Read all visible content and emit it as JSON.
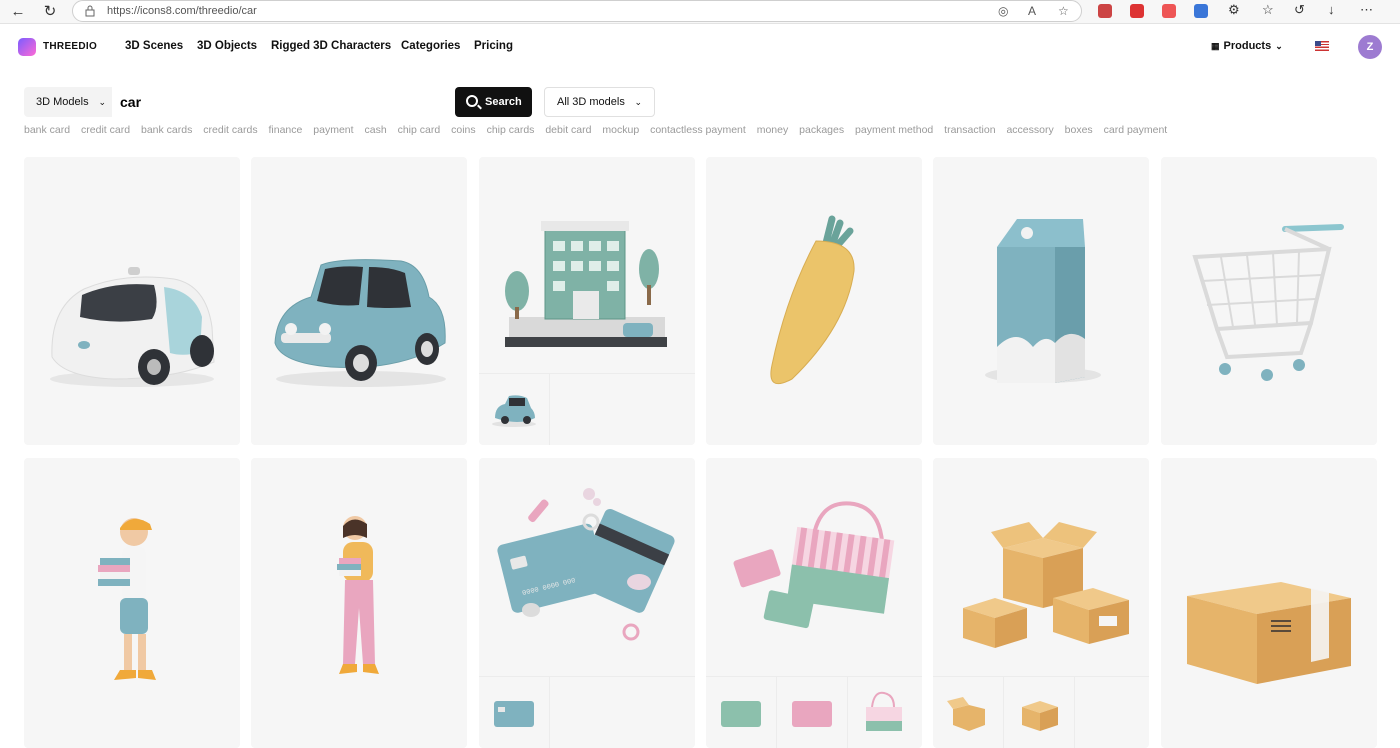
{
  "browser": {
    "url": "https://icons8.com/threedio/car"
  },
  "header": {
    "logo": "THREEDIO",
    "nav": [
      "3D Scenes",
      "3D Objects",
      "Rigged 3D Characters",
      "Categories",
      "Pricing"
    ],
    "products": "Products",
    "avatar_initial": "Z"
  },
  "search": {
    "type_label": "3D Models",
    "query": "car",
    "button": "Search",
    "scope_label": "All 3D models",
    "tags": [
      "bank card",
      "credit card",
      "bank cards",
      "credit cards",
      "finance",
      "payment",
      "cash",
      "chip card",
      "coins",
      "chip cards",
      "debit card",
      "mockup",
      "contactless payment",
      "money",
      "packages",
      "payment method",
      "transaction",
      "accessory",
      "boxes",
      "card payment"
    ]
  },
  "results": [
    {
      "name": "self-driving-car-model",
      "thumbs": []
    },
    {
      "name": "retro-car-model",
      "thumbs": []
    },
    {
      "name": "city-building-scene",
      "thumbs": [
        "car"
      ]
    },
    {
      "name": "carrot-model",
      "thumbs": []
    },
    {
      "name": "milk-carton-model",
      "thumbs": []
    },
    {
      "name": "shopping-cart-model",
      "thumbs": []
    },
    {
      "name": "boy-with-books-character",
      "thumbs": []
    },
    {
      "name": "girl-with-books-character",
      "thumbs": []
    },
    {
      "name": "credit-cards-scene",
      "thumbs": [
        "card"
      ]
    },
    {
      "name": "bag-and-cards-scene",
      "thumbs": [
        "card-green",
        "card-pink",
        "bag"
      ]
    },
    {
      "name": "cardboard-boxes-scene",
      "thumbs": [
        "box-open",
        "box-closed"
      ]
    },
    {
      "name": "cardboard-box-model",
      "thumbs": []
    }
  ],
  "colors": {
    "accent": "#111111",
    "teal": "#7fb2bf",
    "pink": "#e9a6bf",
    "cardboard": "#e6b46a"
  }
}
